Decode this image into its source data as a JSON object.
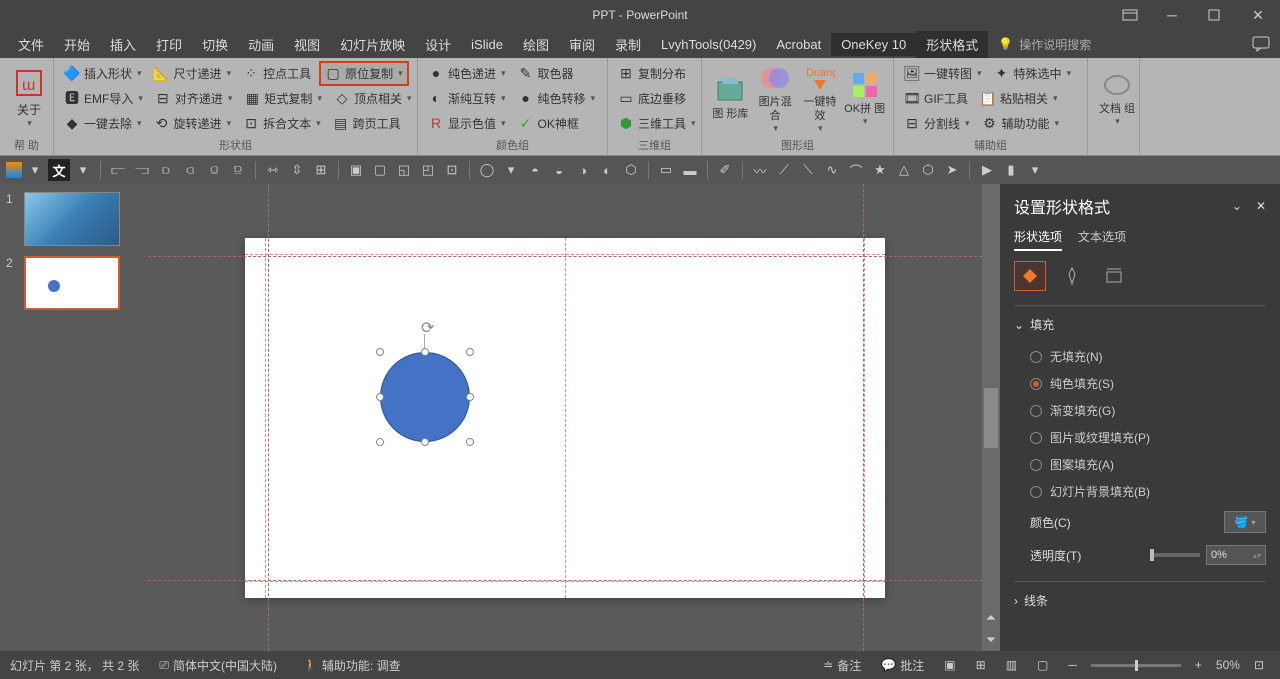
{
  "title": "PPT - PowerPoint",
  "menu": [
    "文件",
    "开始",
    "插入",
    "打印",
    "切换",
    "动画",
    "视图",
    "幻灯片放映",
    "设计",
    "iSlide",
    "绘图",
    "审阅",
    "录制",
    "LvyhTools(0429)",
    "Acrobat",
    "OneKey 10",
    "形状格式"
  ],
  "menu_active": "OneKey 10",
  "menu_context": "形状格式",
  "help_search": "操作说明搜索",
  "ribbon": {
    "help": {
      "label": "帮 助",
      "btn": "关于"
    },
    "shape_group": {
      "label": "形状组",
      "r1": [
        "插入形状",
        "尺寸递进",
        "控点工具",
        "原位复制"
      ],
      "r2": [
        "EMF导入",
        "对齐递进",
        "矩式复制",
        "顶点相关"
      ],
      "r3": [
        "一键去除",
        "旋转递进",
        "拆合文本",
        "跨页工具"
      ]
    },
    "color_group": {
      "label": "颜色组",
      "r1": [
        "纯色递进",
        "取色器"
      ],
      "r2": [
        "渐纯互转",
        "纯色转移"
      ],
      "r3": [
        "显示色值",
        "OK神框"
      ]
    },
    "three_d": {
      "label": "三维组",
      "r1": "复制分布",
      "r2": "底边垂移",
      "r3": "三维工具"
    },
    "graphic": {
      "label": "图形组",
      "lib": "图 形库",
      "mix": "图片混 合",
      "fx": "一键特 效",
      "ok": "OK拼 图"
    },
    "aux": {
      "label": "辅助组",
      "r1": [
        "一键转图",
        "特殊选中"
      ],
      "r2": [
        "GIF工具",
        "粘贴相关"
      ],
      "r3": [
        "分割线",
        "辅助功能"
      ]
    },
    "doc": {
      "label": "",
      "btn": "文档 组"
    }
  },
  "format_panel": {
    "title": "设置形状格式",
    "tabs": [
      "形状选项",
      "文本选项"
    ],
    "fill_section": "填充",
    "fill_options": [
      "无填充(N)",
      "纯色填充(S)",
      "渐变填充(G)",
      "图片或纹理填充(P)",
      "图案填充(A)",
      "幻灯片背景填充(B)"
    ],
    "fill_selected": 1,
    "color_label": "颜色(C)",
    "transparency_label": "透明度(T)",
    "transparency_value": "0%",
    "line_section": "线条"
  },
  "statusbar": {
    "slide_info": "幻灯片 第 2 张， 共 2 张",
    "lang": "简体中文(中国大陆)",
    "access": "辅助功能: 调查",
    "notes": "备注",
    "comments": "批注",
    "zoom": "50%"
  },
  "slide_count": 2,
  "current_slide": 2
}
